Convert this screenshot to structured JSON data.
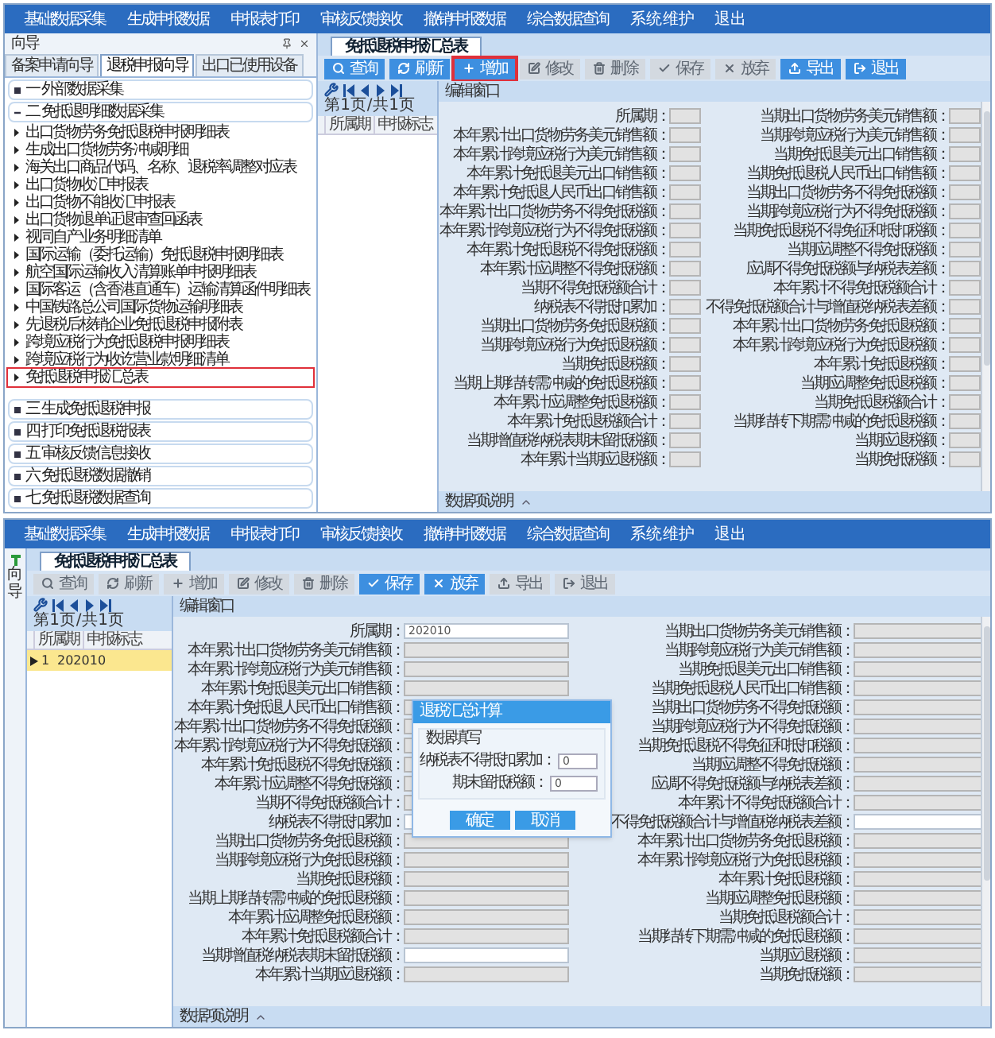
{
  "screens": [
    {
      "menu": [
        "基础数据采集",
        "生成申报数据",
        "申报表打印",
        "审核反馈接收",
        "撤销申报数据",
        "综合数据查询",
        "系 统 维 护",
        "退 出"
      ],
      "nav": {
        "kind": "panel",
        "title": "向导",
        "tabs": [
          {
            "label": "备案申请向导",
            "selected": false
          },
          {
            "label": "退税申报向导",
            "selected": true
          },
          {
            "label": "出口已使用设备",
            "selected": false
          }
        ],
        "sections": [
          {
            "label": "一  外部数据采集",
            "expanded": false
          },
          {
            "label": "二  免抵退明细数据采集",
            "expanded": true,
            "items": [
              {
                "label": "出口货物劳务免抵退税申报明细表",
                "selected": false
              },
              {
                "label": "生成出口货物劳务冲减明细",
                "selected": false
              },
              {
                "label": "海关出口商品代码、名称、退税率调整对应表",
                "selected": false
              },
              {
                "label": "出口货物收汇申报表",
                "selected": false
              },
              {
                "label": "出口货物不能收汇申报表",
                "selected": false
              },
              {
                "label": "出口货物退单证退审查回函表",
                "selected": false
              },
              {
                "label": "视同自产业务明细清单",
                "selected": false
              },
              {
                "label": "国际运输（委托运输）免抵退税申报明细表",
                "selected": false
              },
              {
                "label": "航空国际运输收入清算账单申报明细表",
                "selected": false
              },
              {
                "label": "国际客运（含香港直通车）运输清算函件明细表",
                "selected": false
              },
              {
                "label": "中国铁路总公司国际货物运输明细表",
                "selected": false
              },
              {
                "label": "先退税后核销企业免抵退税申报附表",
                "selected": false
              },
              {
                "label": "跨境应税行为免抵退税申报明细表",
                "selected": false
              },
              {
                "label": "跨境应税行为收讫营业款明细清单",
                "selected": false
              },
              {
                "label": "免抵退税申报汇总表",
                "selected": true
              }
            ]
          },
          {
            "label": "三  生成免抵退税申报",
            "expanded": false
          },
          {
            "label": "四  打印免抵退税报表",
            "expanded": false
          },
          {
            "label": "五  审核反馈信息接收",
            "expanded": false
          },
          {
            "label": "六  免抵退税数据撤销",
            "expanded": false
          },
          {
            "label": "七  免抵退税数据查询",
            "expanded": false
          }
        ]
      },
      "tab": "免抵退税申报汇总表",
      "toolbar": [
        {
          "label": "查询",
          "kind": "search",
          "disabled": false,
          "highlighted": false
        },
        {
          "label": "刷新",
          "kind": "refresh",
          "disabled": false,
          "highlighted": false
        },
        {
          "label": "增加",
          "kind": "add",
          "disabled": false,
          "highlighted": true
        },
        {
          "label": "修改",
          "kind": "edit",
          "disabled": true,
          "highlighted": false
        },
        {
          "label": "删除",
          "kind": "delete",
          "disabled": true,
          "highlighted": false
        },
        {
          "label": "保存",
          "kind": "save",
          "disabled": true,
          "highlighted": false
        },
        {
          "label": "放弃",
          "kind": "cancel",
          "disabled": true,
          "highlighted": false
        },
        {
          "label": "导出",
          "kind": "export",
          "disabled": false,
          "highlighted": false
        },
        {
          "label": "退出",
          "kind": "exit",
          "disabled": false,
          "highlighted": false
        }
      ],
      "pager": "第 1 页 / 共 1 页",
      "list_columns": [
        "所属期",
        "申报标志"
      ],
      "form": {
        "title": "编辑窗口",
        "footer": "数据项说明",
        "left": [
          {
            "label": "所属期：",
            "editable": false
          },
          {
            "label": "本年累计出口货物劳务美元销售额：",
            "editable": false
          },
          {
            "label": "本年累计跨境应税行为美元销售额：",
            "editable": false
          },
          {
            "label": "本年累计免抵退美元出口销售额：",
            "editable": false
          },
          {
            "label": "本年累计免抵退人民币出口销售额：",
            "editable": false
          },
          {
            "label": "本年累计出口货物劳务不得免抵税额：",
            "editable": false
          },
          {
            "label": "本年累计跨境应税行为不得免抵税额：",
            "editable": false
          },
          {
            "label": "本年累计免抵退税不得免抵税额：",
            "editable": false
          },
          {
            "label": "本年累计应调整不得免抵税额：",
            "editable": false
          },
          {
            "label": "当期不得免抵税额合计：",
            "editable": false
          },
          {
            "label": "纳税表不得抵扣累加：",
            "editable": false
          },
          {
            "label": "当期出口货物劳务免抵退税额：",
            "editable": false
          },
          {
            "label": "当期跨境应税行为免抵退税额：",
            "editable": false
          },
          {
            "label": "当期免抵退税额：",
            "editable": false
          },
          {
            "label": "当期上期结转需冲减的免抵退税额：",
            "editable": false
          },
          {
            "label": "本年累计应调整免抵退税额：",
            "editable": false
          },
          {
            "label": "本年累计免抵退税额合计：",
            "editable": false
          },
          {
            "label": "当期增值税纳税表期末留抵税额：",
            "editable": false
          },
          {
            "label": "本年累计当期应退税额：",
            "editable": false
          }
        ],
        "right": [
          {
            "label": "当期出口货物劳务美元销售额：",
            "editable": false
          },
          {
            "label": "当期跨境应税行为美元销售额：",
            "editable": false
          },
          {
            "label": "当期免抵退美元出口销售额：",
            "editable": false
          },
          {
            "label": "当期免抵退税人民币出口销售额：",
            "editable": false
          },
          {
            "label": "当期出口货物劳务不得免抵税额：",
            "editable": false
          },
          {
            "label": "当期跨境应税行为不得免抵税额：",
            "editable": false
          },
          {
            "label": "当期免抵退税不得免征和抵扣税额：",
            "editable": false
          },
          {
            "label": "当期应调整不得免抵税额：",
            "editable": false
          },
          {
            "label": "应调不得免抵税额与纳税表差额：",
            "editable": false
          },
          {
            "label": "本年累计不得免抵税额合计：",
            "editable": false
          },
          {
            "label": "不得免抵税额合计与增值税纳税表差额：",
            "editable": false
          },
          {
            "label": "本年累计出口货物劳务免抵退税额：",
            "editable": false
          },
          {
            "label": "本年累计跨境应税行为免抵退税额：",
            "editable": false
          },
          {
            "label": "本年累计免抵退税额：",
            "editable": false
          },
          {
            "label": "当期应调整免抵退税额：",
            "editable": false
          },
          {
            "label": "当期免抵退税额合计：",
            "editable": false
          },
          {
            "label": "当期结转下期需冲减的免抵退税额：",
            "editable": false
          },
          {
            "label": "当期应退税额：",
            "editable": false
          },
          {
            "label": "当期免抵税额：",
            "editable": false
          }
        ]
      }
    },
    {
      "menu": [
        "基础数据采集",
        "生成申报数据",
        "申报表打印",
        "审核反馈接收",
        "撤销申报数据",
        "综合数据查询",
        "系 统 维 护",
        "退 出"
      ],
      "nav": {
        "kind": "collapsed",
        "title": "向导"
      },
      "tab": "免抵退税申报汇总表",
      "toolbar": [
        {
          "label": "查询",
          "kind": "search",
          "disabled": true,
          "highlighted": false
        },
        {
          "label": "刷新",
          "kind": "refresh",
          "disabled": true,
          "highlighted": false
        },
        {
          "label": "增加",
          "kind": "add",
          "disabled": true,
          "highlighted": false
        },
        {
          "label": "修改",
          "kind": "edit",
          "disabled": true,
          "highlighted": false
        },
        {
          "label": "删除",
          "kind": "delete",
          "disabled": true,
          "highlighted": false
        },
        {
          "label": "保存",
          "kind": "save",
          "disabled": false,
          "highlighted": false
        },
        {
          "label": "放弃",
          "kind": "cancel",
          "disabled": false,
          "highlighted": false
        },
        {
          "label": "导出",
          "kind": "export",
          "disabled": true,
          "highlighted": false
        },
        {
          "label": "退出",
          "kind": "exit",
          "disabled": true,
          "highlighted": false
        }
      ],
      "pager": "第 1 页 / 共 1 页",
      "list_columns": [
        "所属期",
        "申报标志"
      ],
      "list_rows": [
        {
          "number": "1",
          "period": "202010",
          "selected": true
        }
      ],
      "form": {
        "title": "编辑窗口",
        "footer": "数据项说明",
        "left": [
          {
            "label": "所属期：",
            "editable": true,
            "value": "202010"
          },
          {
            "label": "本年累计出口货物劳务美元销售额：",
            "editable": false
          },
          {
            "label": "本年累计跨境应税行为美元销售额：",
            "editable": false
          },
          {
            "label": "本年累计免抵退美元出口销售额：",
            "editable": false
          },
          {
            "label": "本年累计免抵退人民币出口销售额：",
            "editable": false
          },
          {
            "label": "本年累计出口货物劳务不得免抵税额：",
            "editable": false
          },
          {
            "label": "本年累计跨境应税行为不得免抵税额：",
            "editable": false
          },
          {
            "label": "本年累计免抵退税不得免抵税额：",
            "editable": false
          },
          {
            "label": "本年累计应调整不得免抵税额：",
            "editable": false
          },
          {
            "label": "当期不得免抵税额合计：",
            "editable": false
          },
          {
            "label": "纳税表不得抵扣累加：",
            "editable": true
          },
          {
            "label": "当期出口货物劳务免抵退税额：",
            "editable": false
          },
          {
            "label": "当期跨境应税行为免抵退税额：",
            "editable": false
          },
          {
            "label": "当期免抵退税额：",
            "editable": false
          },
          {
            "label": "当期上期结转需冲减的免抵退税额：",
            "editable": false
          },
          {
            "label": "本年累计应调整免抵退税额：",
            "editable": false
          },
          {
            "label": "本年累计免抵退税额合计：",
            "editable": false
          },
          {
            "label": "当期增值税纳税表期末留抵税额：",
            "editable": true
          },
          {
            "label": "本年累计当期应退税额：",
            "editable": false
          }
        ],
        "right": [
          {
            "label": "当期出口货物劳务美元销售额：",
            "editable": false
          },
          {
            "label": "当期跨境应税行为美元销售额：",
            "editable": false
          },
          {
            "label": "当期免抵退美元出口销售额：",
            "editable": false
          },
          {
            "label": "当期免抵退税人民币出口销售额：",
            "editable": false
          },
          {
            "label": "当期出口货物劳务不得免抵税额：",
            "editable": false
          },
          {
            "label": "当期跨境应税行为不得免抵税额：",
            "editable": false
          },
          {
            "label": "当期免抵退税不得免征和抵扣税额：",
            "editable": false
          },
          {
            "label": "当期应调整不得免抵税额：",
            "editable": false
          },
          {
            "label": "应调不得免抵税额与纳税表差额：",
            "editable": false
          },
          {
            "label": "本年累计不得免抵税额合计：",
            "editable": false
          },
          {
            "label": "不得免抵税额合计与增值税纳税表差额：",
            "editable": true
          },
          {
            "label": "本年累计出口货物劳务免抵退税额：",
            "editable": false
          },
          {
            "label": "本年累计跨境应税行为免抵退税额：",
            "editable": false
          },
          {
            "label": "本年累计免抵退税额：",
            "editable": false
          },
          {
            "label": "当期应调整免抵退税额：",
            "editable": false
          },
          {
            "label": "当期免抵退税额合计：",
            "editable": false
          },
          {
            "label": "当期结转下期需冲减的免抵退税额：",
            "editable": false
          },
          {
            "label": "当期应退税额：",
            "editable": false
          },
          {
            "label": "当期免抵税额：",
            "editable": false
          }
        ]
      },
      "dialog": {
        "title": "退税汇总计算",
        "group": "数据填写",
        "fields": [
          {
            "label": "纳税表不得抵扣累加：",
            "value": "0"
          },
          {
            "label": "期末留抵税额：",
            "value": "0"
          }
        ],
        "buttons": [
          "确定",
          "取消"
        ]
      }
    }
  ]
}
